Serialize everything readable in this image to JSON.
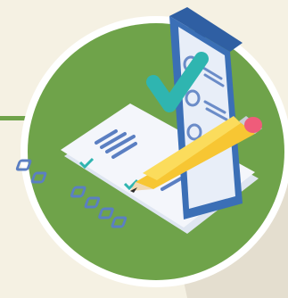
{
  "illustration": {
    "subject": "checklist-with-phone-and-pencil",
    "icons": [
      "phone-icon",
      "checklist-paper-icon",
      "pencil-icon",
      "checkmark-icon"
    ],
    "colors": {
      "background": "#f5f1e3",
      "circle_fill": "#6fa34a",
      "circle_ring": "#ffffff",
      "accent_line": "#6fa34a",
      "phone_body": "#3b6fb6",
      "phone_screen": "#e8eef8",
      "paper": "#f4f6fb",
      "paper_marks": "#5b7fc2",
      "check": "#2fb5b0",
      "pencil_body": "#f7c633",
      "pencil_eraser": "#ef5c7a",
      "shadow": "#b9c9a6"
    }
  }
}
